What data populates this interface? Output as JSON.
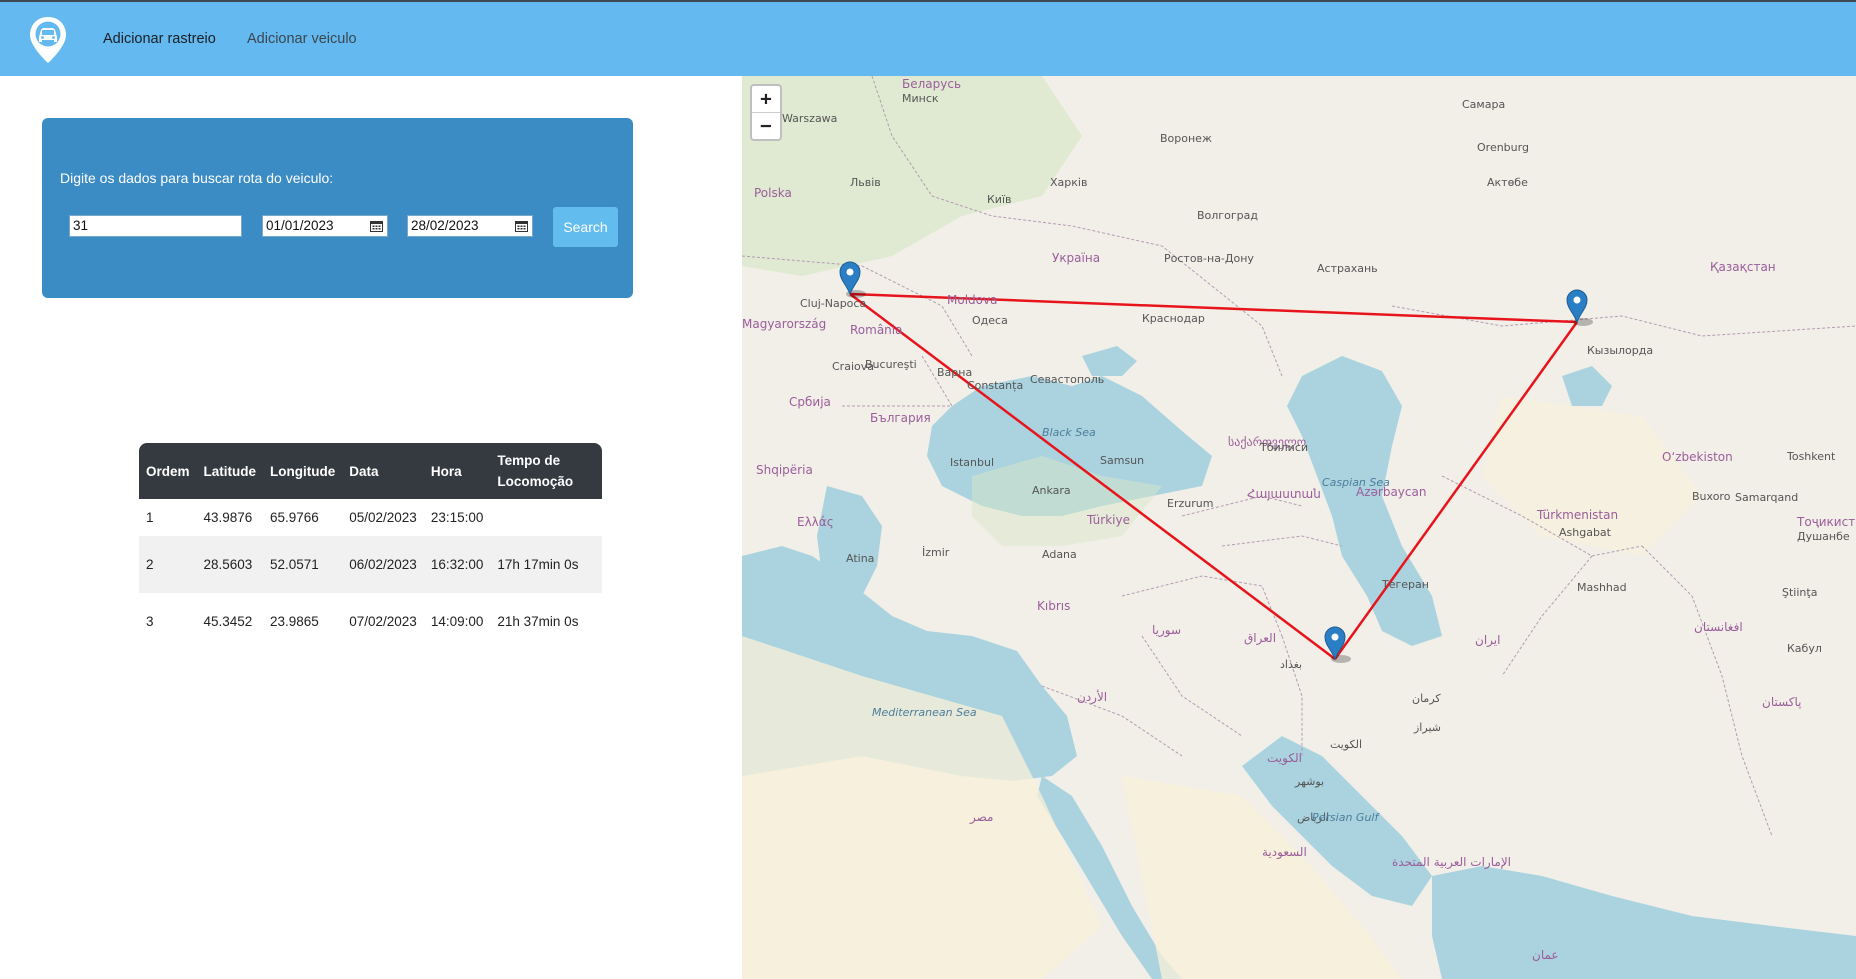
{
  "navbar": {
    "logo_icon": "car-location-pin-icon",
    "links": [
      {
        "label": "Adicionar rastreio"
      },
      {
        "label": "Adicionar veiculo"
      }
    ]
  },
  "search": {
    "prompt": "Digite os dados para buscar rota do veiculo:",
    "vehicle_id": "31",
    "date_start": "01/01/2023",
    "date_end": "28/02/2023",
    "button_label": "Search"
  },
  "route_table": {
    "columns": [
      "Ordem",
      "Latitude",
      "Longitude",
      "Data",
      "Hora",
      "Tempo de Locomoção"
    ],
    "rows": [
      {
        "ordem": "1",
        "latitude": "43.9876",
        "longitude": "65.9766",
        "data": "05/02/2023",
        "hora": "23:15:00",
        "tempo": ""
      },
      {
        "ordem": "2",
        "latitude": "28.5603",
        "longitude": "52.0571",
        "data": "06/02/2023",
        "hora": "16:32:00",
        "tempo": "17h 17min 0s"
      },
      {
        "ordem": "3",
        "latitude": "45.3452",
        "longitude": "23.9865",
        "data": "07/02/2023",
        "hora": "14:09:00",
        "tempo": "21h 37min 0s"
      }
    ]
  },
  "map": {
    "zoom_in": "+",
    "zoom_out": "−",
    "route_color": "#e8141b",
    "marker_color": "#2a7fc4",
    "labels": {
      "countries": [
        "Беларусь",
        "Україна",
        "Moldova",
        "România",
        "България",
        "Türkiye",
        "Қазақстан",
        "Oʻzbekiston",
        "Türkmenistan",
        "ایران",
        "العراق",
        "السعودية",
        "Србија",
        "Ελλάς",
        "Azərbaycan",
        "საქართველო",
        "Հայաստան",
        "Shqipëria",
        "Kıbrıs",
        "افغانستان",
        "پاکستان",
        "Тоҷикистон",
        "Magyarország",
        "Polska",
        "الأردن",
        "سوريا",
        "الكويت",
        "عمان",
        "مصر",
        "الإمارات العربية المتحدة"
      ],
      "cities": [
        "Минск",
        "Київ",
        "Одеса",
        "Bucureşti",
        "Constanța",
        "Севастополь",
        "Istanbul",
        "Ankara",
        "Samsun",
        "Тбилиси",
        "Волгоград",
        "Астрахань",
        "Тегеран",
        "بغداد",
        "الرياض",
        "Ashgabat",
        "Buxoro",
        "Samarqand",
        "Toshkent",
        "Душанбе",
        "Краснодар",
        "Ростов-на-Дону",
        "Харків",
        "Львів",
        "Warszawa",
        "Кабул",
        "Актөбе",
        "Orenburg",
        "Самара",
        "Воронеж",
        "Craiova",
        "Варна",
        "Cluj-Napoca",
        "Ştiinţa",
        "Atina",
        "İzmir",
        "Adana",
        "Erzurum",
        "Mashhad",
        "کرمان",
        "شیراز",
        "بوشهر",
        "الكويت",
        "Кызылорда"
      ],
      "seas": [
        "Black Sea",
        "Caspian Sea",
        "Persian Gulf",
        "Mediterranean Sea"
      ]
    }
  }
}
